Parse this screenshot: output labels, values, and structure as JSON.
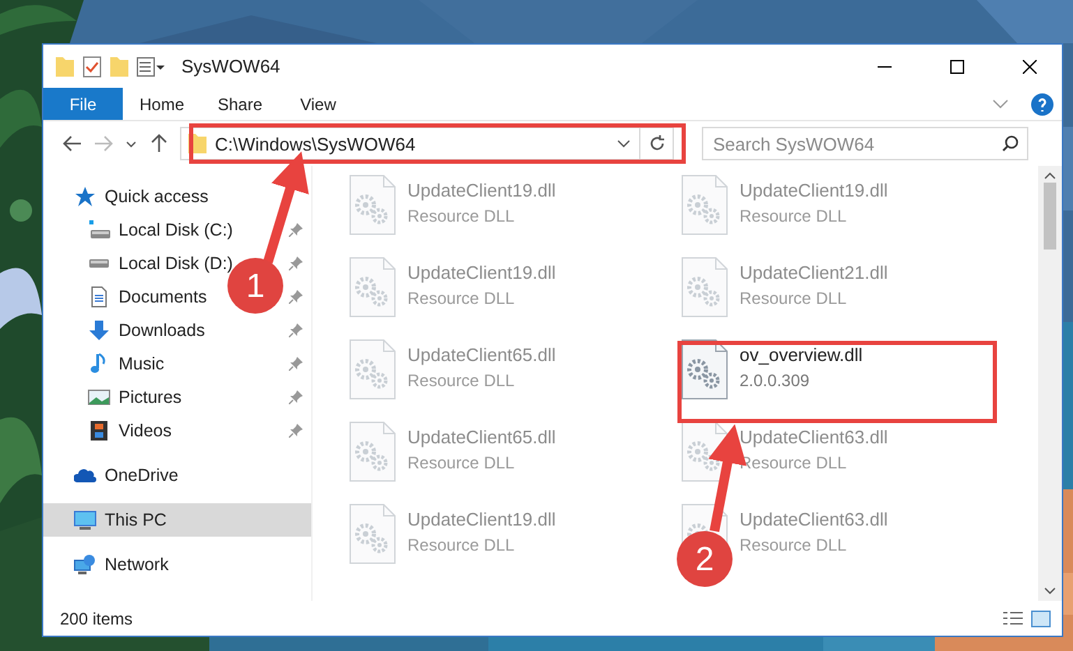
{
  "window": {
    "title": "SysWOW64"
  },
  "ribbon_tabs": [
    {
      "label": "File",
      "kind": "file"
    },
    {
      "label": "Home",
      "kind": "tab"
    },
    {
      "label": "Share",
      "kind": "tab"
    },
    {
      "label": "View",
      "kind": "tab"
    }
  ],
  "address": {
    "path": "C:\\Windows\\SysWOW64"
  },
  "search": {
    "placeholder": "Search SysWOW64"
  },
  "nav": [
    {
      "label": "Quick access",
      "kind": "star",
      "selected": false,
      "children": [
        {
          "label": "Local Disk (C:)",
          "kind": "drive-c",
          "selected": false,
          "pinned": true
        },
        {
          "label": "Local Disk (D:)",
          "kind": "drive",
          "selected": false,
          "pinned": true
        },
        {
          "label": "Documents",
          "kind": "document",
          "selected": false,
          "pinned": true
        },
        {
          "label": "Downloads",
          "kind": "download",
          "selected": false,
          "pinned": true
        },
        {
          "label": "Music",
          "kind": "music",
          "selected": false,
          "pinned": true
        },
        {
          "label": "Pictures",
          "kind": "pictures",
          "selected": false,
          "pinned": true
        },
        {
          "label": "Videos",
          "kind": "videos",
          "selected": false,
          "pinned": true
        }
      ]
    },
    {
      "label": "OneDrive",
      "kind": "cloud",
      "selected": false
    },
    {
      "label": "This PC",
      "kind": "pc",
      "selected": true
    },
    {
      "label": "Network",
      "kind": "network",
      "selected": false
    }
  ],
  "files": [
    {
      "name": "UpdateClient19.dll",
      "detail": "Resource DLL",
      "blurred": true
    },
    {
      "name": "UpdateClient19.dll",
      "detail": "Resource DLL",
      "blurred": true
    },
    {
      "name": "UpdateClient19.dll",
      "detail": "Resource DLL",
      "blurred": true
    },
    {
      "name": "UpdateClient21.dll",
      "detail": "Resource DLL",
      "blurred": true
    },
    {
      "name": "UpdateClient65.dll",
      "detail": "Resource DLL",
      "blurred": true
    },
    {
      "name": "ov_overview.dll",
      "detail": "2.0.0.309",
      "blurred": false
    },
    {
      "name": "UpdateClient65.dll",
      "detail": "Resource DLL",
      "blurred": true
    },
    {
      "name": "UpdateClient63.dll",
      "detail": "Resource DLL",
      "blurred": true
    },
    {
      "name": "UpdateClient19.dll",
      "detail": "Resource DLL",
      "blurred": true
    },
    {
      "name": "UpdateClient63.dll",
      "detail": "Resource DLL",
      "blurred": true
    }
  ],
  "status_bar": {
    "count": "200 items"
  },
  "annotations": [
    {
      "number": "1"
    },
    {
      "number": "2"
    }
  ]
}
